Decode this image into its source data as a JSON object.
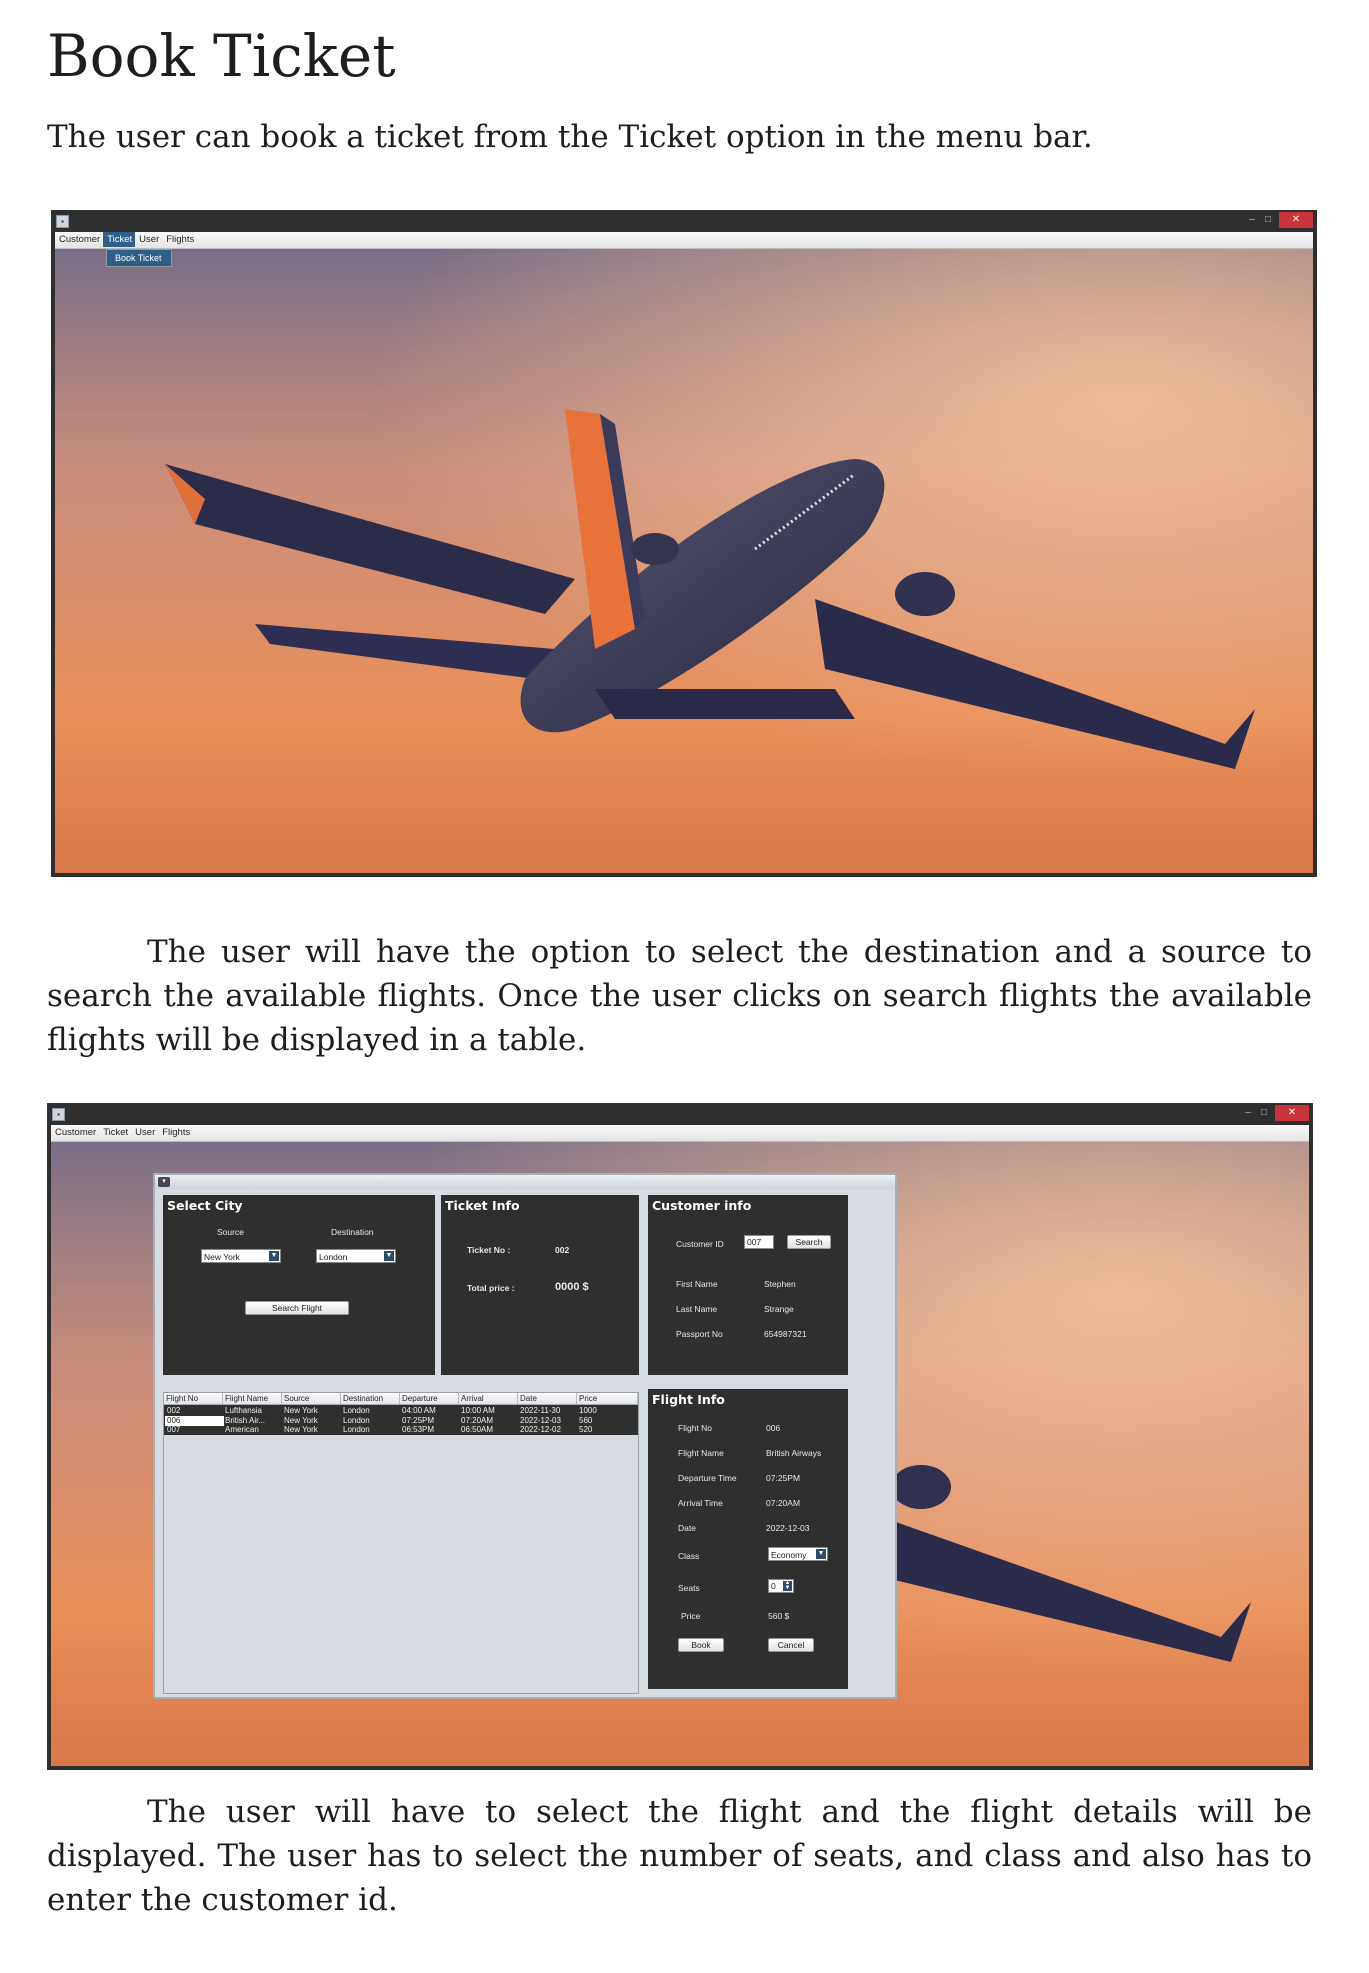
{
  "heading": "Book Ticket",
  "para1": "The user can book a ticket from the Ticket option in the menu bar.",
  "para2": "The user will have the option to select the destination and a source to search the available flights. Once the user clicks on search flights the available flights will be displayed in a table.",
  "para3": "The user will have to select the flight and the flight details will be displayed. The user has to select the number of seats, and class and also has to enter the customer id.",
  "window_controls": {
    "minimize": "–",
    "maximize": "□",
    "close": "✕"
  },
  "menu": [
    "Customer",
    "Ticket",
    "User",
    "Flights"
  ],
  "dropdown_item": "Book Ticket",
  "colors": {
    "accent": "#2d5f8a",
    "panel": "#2f2f2f",
    "close": "#c8343a"
  },
  "select_city": {
    "title": "Select City",
    "source_label": "Source",
    "destination_label": "Destination",
    "source_value": "New York",
    "destination_value": "London",
    "search_button": "Search Flight"
  },
  "ticket_info": {
    "title": "Ticket Info",
    "ticket_no_label": "Ticket No :",
    "ticket_no": "002",
    "total_price_label": "Total price :",
    "total_price": "0000 $"
  },
  "customer_info": {
    "title": "Customer info",
    "customer_id_label": "Customer ID",
    "customer_id": "007",
    "search_button": "Search",
    "first_name_label": "First Name",
    "first_name": "Stephen",
    "last_name_label": "Last Name",
    "last_name": "Strange",
    "passport_label": "Passport No",
    "passport": "654987321"
  },
  "flights_table": {
    "headers": [
      "Flight No",
      "Flight Name",
      "Source",
      "Destination",
      "Departure",
      "Arrival",
      "Date",
      "Price"
    ],
    "rows": [
      [
        "002",
        "Lufthansia",
        "New York",
        "London",
        "04:00 AM",
        "10:00 AM",
        "2022-11-30",
        "1000"
      ],
      [
        "006",
        "British Air...",
        "New York",
        "London",
        "07:25PM",
        "07:20AM",
        "2022-12-03",
        "560"
      ],
      [
        "007",
        "American",
        "New York",
        "London",
        "06:53PM",
        "06:50AM",
        "2022-12-02",
        "520"
      ]
    ]
  },
  "flight_info": {
    "title": "Flight Info",
    "flight_no_label": "Flight No",
    "flight_no": "006",
    "flight_name_label": "Flight Name",
    "flight_name": "British Airways",
    "departure_label": "Departure Time",
    "departure": "07:25PM",
    "arrival_label": "Arrival Time",
    "arrival": "07:20AM",
    "date_label": "Date",
    "date": "2022-12-03",
    "class_label": "Class",
    "class": "Economy",
    "seats_label": "Seats",
    "seats": "0",
    "price_label": "Price",
    "price": "560 $",
    "book_button": "Book",
    "cancel_button": "Cancel"
  }
}
